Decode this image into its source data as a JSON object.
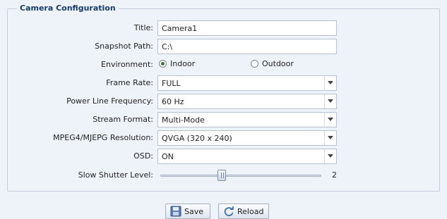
{
  "section": {
    "legend": "Camera Configuration"
  },
  "fields": {
    "title": {
      "label": "Title:",
      "value": "Camera1"
    },
    "snapshot_path": {
      "label": "Snapshot Path:",
      "value": "C:\\"
    },
    "environment": {
      "label": "Environment:",
      "options": [
        "Indoor",
        "Outdoor"
      ],
      "selected": "Indoor"
    },
    "frame_rate": {
      "label": "Frame Rate:",
      "value": "FULL"
    },
    "power_line_frequency": {
      "label": "Power Line Frequency:",
      "value": "60 Hz"
    },
    "stream_format": {
      "label": "Stream Format:",
      "value": "Multi-Mode"
    },
    "resolution": {
      "label": "MPEG4/MJEPG Resolution:",
      "value": "QVGA (320 x 240)"
    },
    "osd": {
      "label": "OSD:",
      "value": "ON"
    },
    "slow_shutter_level": {
      "label": "Slow Shutter Level:",
      "value": "2"
    }
  },
  "buttons": {
    "save": "Save",
    "reload": "Reload"
  },
  "icons": {
    "save": "floppy-disk-icon",
    "reload": "refresh-icon",
    "dropdown": "chevron-down-icon"
  },
  "colors": {
    "legend": "#1a3a6e",
    "background": "#eef2f9",
    "radio_selected": "#3b7a2e"
  }
}
